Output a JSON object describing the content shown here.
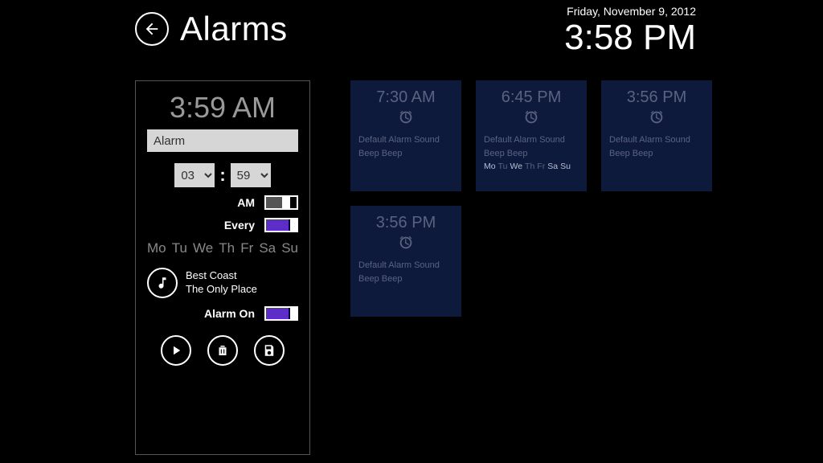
{
  "header": {
    "title": "Alarms"
  },
  "clock": {
    "date": "Friday, November 9, 2012",
    "time": "3:58 PM"
  },
  "editor": {
    "display_time": "3:59 AM",
    "name_value": "Alarm",
    "hour": "03",
    "minute": "59",
    "ampm_label": "AM",
    "ampm_on": false,
    "repeat_label": "Every",
    "repeat_on": true,
    "days": [
      "Mo",
      "Tu",
      "We",
      "Th",
      "Fr",
      "Sa",
      "Su"
    ],
    "sound_artist": "Best Coast",
    "sound_track": "The Only Place",
    "on_label": "Alarm On",
    "alarm_on": true
  },
  "tiles": [
    {
      "time": "7:30 AM",
      "line1": "Default Alarm Sound",
      "line2": "Beep Beep",
      "days": null
    },
    {
      "time": "6:45 PM",
      "line1": "Default Alarm Sound",
      "line2": "Beep Beep",
      "days": [
        "Mo",
        "Tu",
        "We",
        "Th",
        "Fr",
        "Sa",
        "Su"
      ],
      "days_on": [
        "Mo",
        "We",
        "Sa",
        "Su"
      ]
    },
    {
      "time": "3:56 PM",
      "line1": "Default Alarm Sound",
      "line2": "Beep Beep",
      "days": null
    },
    {
      "time": "3:56 PM",
      "line1": "Default Alarm Sound",
      "line2": "Beep Beep",
      "days": null
    }
  ]
}
